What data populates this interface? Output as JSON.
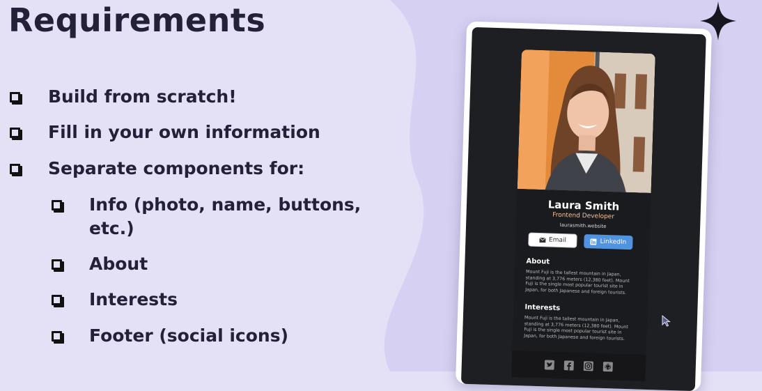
{
  "slide": {
    "title": "Requirements",
    "items": [
      {
        "text": "Build from scratch!"
      },
      {
        "text": "Fill in your own information"
      },
      {
        "text": "Separate components for:"
      },
      {
        "text": "Info (photo, name, buttons,"
      },
      {
        "text": "etc.)"
      },
      {
        "text": "About"
      },
      {
        "text": "Interests"
      },
      {
        "text": "Footer (social icons)"
      }
    ]
  },
  "card": {
    "name": "Laura Smith",
    "role": "Frontend Developer",
    "website": "laurasmith.website",
    "email_label": "Email",
    "linkedin_label": "LinkedIn",
    "about_heading": "About",
    "about_text": "Mount Fuji is the tallest mountain in Japan, standing at 3,776 meters (12,380 feet). Mount Fuji is the single most popular tourist site in Japan, for both Japanese and foreign tourists.",
    "interests_heading": "Interests",
    "interests_text": "Mount Fuji is the tallest mountain in Japan, standing at 3,776 meters (12,380 feet). Mount Fuji is the single most popular tourist site in Japan, for both Japanese and foreign tourists.",
    "social_icons": [
      "twitter-icon",
      "facebook-icon",
      "instagram-icon",
      "github-icon"
    ]
  },
  "colors": {
    "background": "#e4e1f7",
    "title": "#23213a",
    "card_dark": "#1a1b1f",
    "role_accent": "#f3bf99",
    "linkedin_blue": "#5093e1"
  }
}
